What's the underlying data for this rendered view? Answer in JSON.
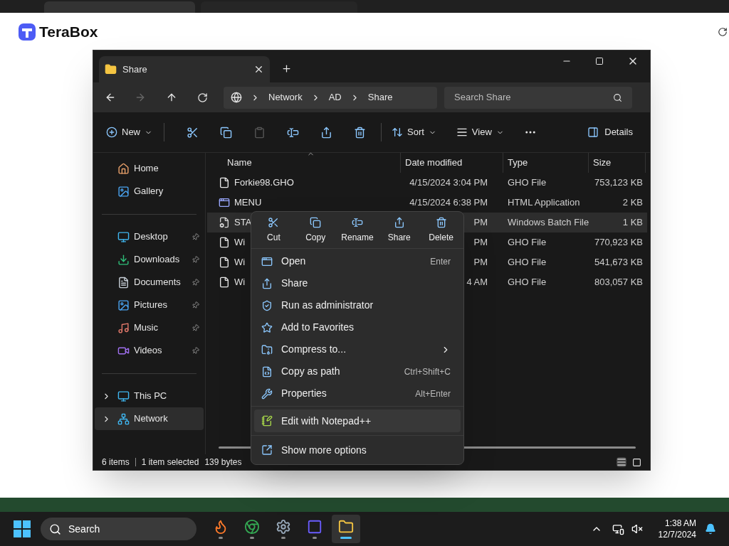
{
  "site": {
    "brand": "TeraBox"
  },
  "explorer": {
    "tabs": [
      {
        "label": "Share",
        "selected": true
      }
    ],
    "breadcrumb": [
      "Network",
      "AD",
      "Share"
    ],
    "search": {
      "placeholder": "Search Share"
    },
    "toolbar": {
      "new": "New",
      "icon_actions": [
        {
          "disabled": false
        },
        {
          "disabled": false
        },
        {
          "disabled": true
        },
        {
          "disabled": false
        },
        {
          "disabled": false
        },
        {
          "disabled": false
        }
      ],
      "sort": "Sort",
      "view": "View",
      "details": "Details"
    },
    "sidebar": {
      "groups": [
        [
          {
            "label": "Home",
            "pinned": false,
            "expandable": false,
            "selected": false
          },
          {
            "label": "Gallery",
            "pinned": false,
            "expandable": false,
            "selected": false
          }
        ],
        [
          {
            "label": "Desktop",
            "pinned": true,
            "expandable": false,
            "selected": false
          },
          {
            "label": "Downloads",
            "pinned": true,
            "expandable": false,
            "selected": false
          },
          {
            "label": "Documents",
            "pinned": true,
            "expandable": false,
            "selected": false
          },
          {
            "label": "Pictures",
            "pinned": true,
            "expandable": false,
            "selected": false
          },
          {
            "label": "Music",
            "pinned": true,
            "expandable": false,
            "selected": false
          },
          {
            "label": "Videos",
            "pinned": true,
            "expandable": false,
            "selected": false
          }
        ],
        [
          {
            "label": "This PC",
            "pinned": false,
            "expandable": true,
            "selected": false
          },
          {
            "label": "Network",
            "pinned": false,
            "expandable": true,
            "selected": true
          }
        ]
      ]
    },
    "columns": [
      "Name",
      "Date modified",
      "Type",
      "Size"
    ],
    "rows": [
      {
        "kind": "file",
        "name": "Forkie98.GHO",
        "date": "4/15/2024 3:04 PM",
        "type": "GHO File",
        "size": "753,123 KB",
        "selected": false
      },
      {
        "kind": "app",
        "name": "MENU",
        "date": "4/15/2024 6:38 PM",
        "type": "HTML Application",
        "size": "2 KB",
        "selected": false
      },
      {
        "kind": "batch",
        "name": "STA",
        "date": "PM",
        "type": "Windows Batch File",
        "size": "1 KB",
        "selected": true
      },
      {
        "kind": "file",
        "name": "Wi",
        "date": "PM",
        "type": "GHO File",
        "size": "770,923 KB",
        "selected": false
      },
      {
        "kind": "file",
        "name": "Wi",
        "date": "PM",
        "type": "GHO File",
        "size": "541,673 KB",
        "selected": false
      },
      {
        "kind": "file",
        "name": "Wi",
        "date": "4 AM",
        "type": "GHO File",
        "size": "803,057 KB",
        "selected": false
      }
    ],
    "status": [
      "6 items",
      "1 item selected",
      "139 bytes"
    ]
  },
  "context_menu": {
    "quick_actions": [
      "Cut",
      "Copy",
      "Rename",
      "Share",
      "Delete"
    ],
    "items": [
      {
        "label": "Open",
        "shortcut": "Enter",
        "submenu": false
      },
      {
        "label": "Share",
        "submenu": false
      },
      {
        "label": "Run as administrator",
        "submenu": false
      },
      {
        "label": "Add to Favorites",
        "submenu": false
      },
      {
        "label": "Compress to...",
        "submenu": true
      },
      {
        "label": "Copy as path",
        "shortcut": "Ctrl+Shift+C",
        "submenu": false
      },
      {
        "label": "Properties",
        "shortcut": "Alt+Enter",
        "submenu": false
      }
    ],
    "extra_items": [
      {
        "label": "Edit with Notepad++",
        "highlighted": true
      }
    ],
    "footer_item": "Show more options"
  },
  "taskbar": {
    "search": "Search",
    "apps": [
      {
        "active": false
      },
      {
        "active": false
      },
      {
        "active": false
      },
      {
        "active": false
      },
      {
        "active": true
      }
    ],
    "time": "1:38 AM",
    "date": "12/7/2024"
  }
}
